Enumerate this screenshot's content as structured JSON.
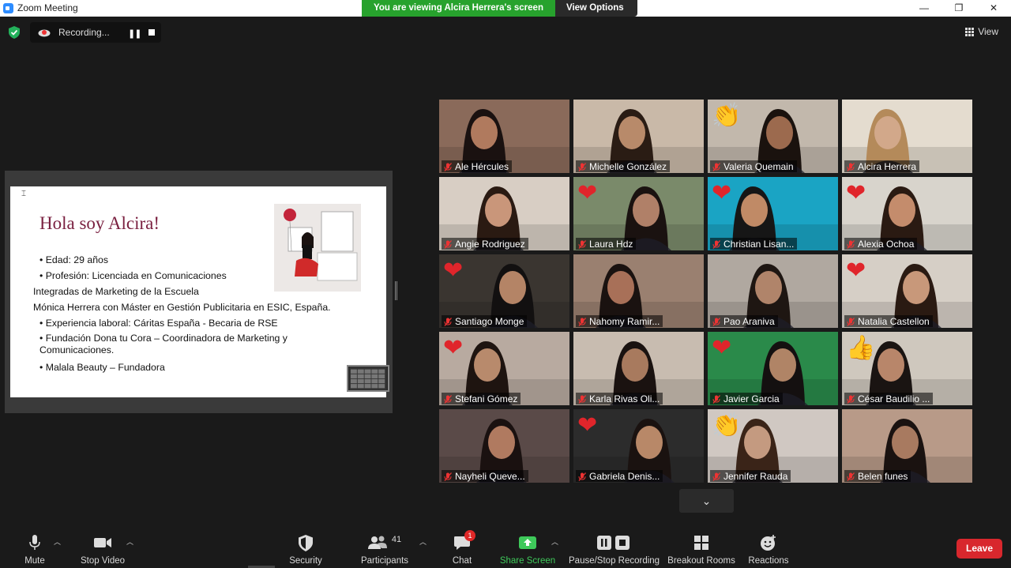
{
  "window": {
    "title": "Zoom Meeting",
    "banner": "You are viewing Alcira Herrera's screen",
    "view_options": "View Options ⌄",
    "controls": [
      "—",
      "❐",
      "✕"
    ]
  },
  "topbar": {
    "recording_label": "Recording...",
    "pause_glyph": "❚❚",
    "view_label": "View"
  },
  "slide": {
    "title": "Hola soy Alcira!",
    "lines": [
      "• Edad: 29 años",
      "• Profesión: Licenciada en Comunicaciones",
      "Integradas de Marketing de la Escuela",
      "Mónica Herrera con Máster en Gestión Publicitaria en ESIC, España.",
      "• Experiencia laboral: Cáritas España - Becaria de RSE",
      "• Fundación Dona tu Cora – Coordinadora de Marketing y Comunicaciones.",
      "• Malala Beauty – Fundadora"
    ]
  },
  "participants": [
    {
      "name": "Ale Hércules",
      "reaction": "",
      "bg": "#8a6a5a",
      "face": "#b07a5e",
      "hair": "#1a1110"
    },
    {
      "name": "Michelle González",
      "reaction": "",
      "bg": "#c9b9a8",
      "face": "#b88a6a",
      "hair": "#2a1c14",
      "active": true
    },
    {
      "name": "Valeria Quemain",
      "reaction": "👏",
      "bg": "#c2b8ac",
      "face": "#9c6a4e",
      "hair": "#1a120e"
    },
    {
      "name": "Alcira Herrera",
      "reaction": "",
      "bg": "#e4dccf",
      "face": "#d2a88a",
      "hair": "#b48a5a"
    },
    {
      "name": "Angie Rodriguez",
      "reaction": "",
      "bg": "#d8cec4",
      "face": "#c9967a",
      "hair": "#2a1a12"
    },
    {
      "name": "Laura Hdz",
      "reaction": "❤",
      "bg": "#7a8a6a",
      "face": "#b08068",
      "hair": "#1a1210"
    },
    {
      "name": "Christian Lisan...",
      "reaction": "❤",
      "bg": "#1aa4c4",
      "face": "#c08a66",
      "hair": "#161616"
    },
    {
      "name": "Alexia Ochoa",
      "reaction": "❤",
      "bg": "#d8d4cc",
      "face": "#c48c6c",
      "hair": "#2a1a12"
    },
    {
      "name": "Santiago Monge",
      "reaction": "❤",
      "bg": "#3a3530",
      "face": "#b48466",
      "hair": "#121010"
    },
    {
      "name": "Nahomy Ramir...",
      "reaction": "",
      "bg": "#9a8070",
      "face": "#a87058",
      "hair": "#1a1210"
    },
    {
      "name": "Pao Aranivа",
      "reaction": "",
      "bg": "#b0a8a0",
      "face": "#b0846a",
      "hair": "#1e1612"
    },
    {
      "name": "Natalia Castellon",
      "reaction": "❤",
      "bg": "#d6cfc6",
      "face": "#c8987a",
      "hair": "#2a1a12"
    },
    {
      "name": "Stefani Gómez",
      "reaction": "❤",
      "bg": "#b8aaa0",
      "face": "#b88a6c",
      "hair": "#1e1410"
    },
    {
      "name": "Karla Rivas Oli...",
      "reaction": "",
      "bg": "#c8bcb0",
      "face": "#a87a5e",
      "hair": "#1a1210"
    },
    {
      "name": "Javier Garcia",
      "reaction": "❤",
      "bg": "#2a8a4a",
      "face": "#b08466",
      "hair": "#141010"
    },
    {
      "name": "César Baudilio ...",
      "reaction": "👍",
      "bg": "#cfc8be",
      "face": "#b8866a",
      "hair": "#1a1412"
    },
    {
      "name": "Nayheli Queve...",
      "reaction": "",
      "bg": "#5a4a48",
      "face": "#b07a60",
      "hair": "#1a1110"
    },
    {
      "name": "Gabriela Denis...",
      "reaction": "❤",
      "bg": "#2c2c2c",
      "face": "#b88868",
      "hair": "#1a1210"
    },
    {
      "name": "Jennifer Rauda",
      "reaction": "👏",
      "bg": "#d0c8c2",
      "face": "#c49a80",
      "hair": "#3a2418"
    },
    {
      "name": "Belen funes",
      "reaction": "",
      "bg": "#b89a88",
      "face": "#a87a60",
      "hair": "#1a1210"
    }
  ],
  "toolbar": {
    "mute": "Mute",
    "stop_video": "Stop Video",
    "security": "Security",
    "participants": "Participants",
    "participants_count": "41",
    "chat": "Chat",
    "chat_badge": "1",
    "share_screen": "Share Screen",
    "pause_recording": "Pause/Stop Recording",
    "breakout": "Breakout Rooms",
    "reactions": "Reactions",
    "leave": "Leave"
  },
  "colors": {
    "banner_green": "#27a22d",
    "active_speaker": "#a5d84e",
    "leave_red": "#d8272d",
    "slide_title": "#7a2040"
  }
}
